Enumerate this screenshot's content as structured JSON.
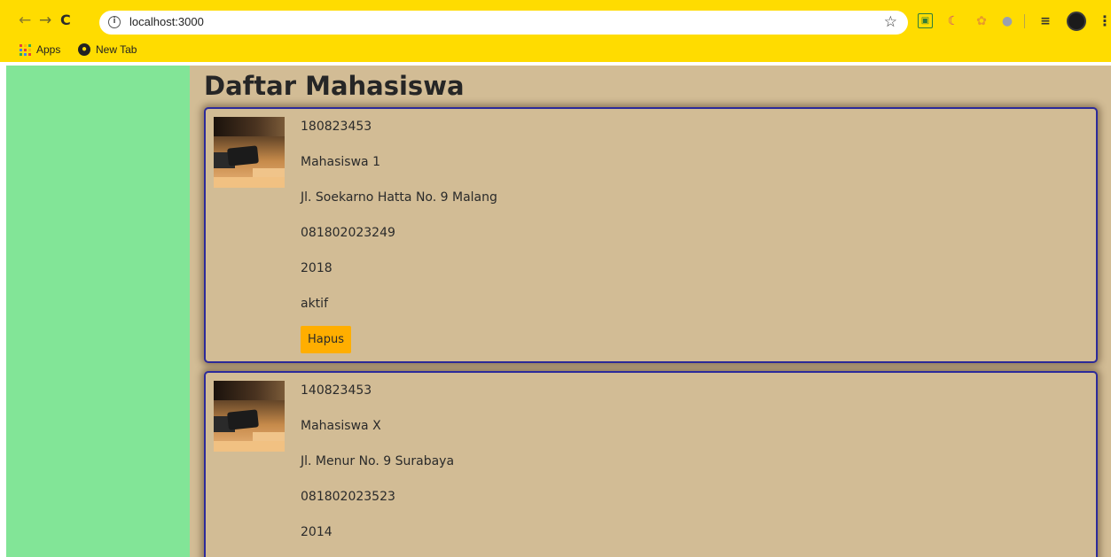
{
  "browser": {
    "back_icon": "arrow-left-icon",
    "forward_icon": "arrow-right-icon",
    "reload_icon": "reload-icon",
    "url": "localhost:3000",
    "bookmarks": [
      {
        "label": "Apps",
        "icon": "apps-grid-icon"
      },
      {
        "label": "New Tab",
        "icon": "globe-icon"
      }
    ],
    "accent_color": "#ffdc00"
  },
  "page": {
    "title": "Daftar Mahasiswa",
    "sidebar_color": "#82e597",
    "main_color": "#d2bc95",
    "card_border_color": "#2c2a9a",
    "button_color": "#ffae00"
  },
  "students": [
    {
      "nim": "180823453",
      "nama": "Mahasiswa 1",
      "alamat": "Jl. Soekarno Hatta No. 9 Malang",
      "hp": "081802023249",
      "angkatan": "2018",
      "status": "aktif",
      "delete_label": "Hapus"
    },
    {
      "nim": "140823453",
      "nama": "Mahasiswa X",
      "alamat": "Jl. Menur No. 9 Surabaya",
      "hp": "081802023523",
      "angkatan": "2014"
    }
  ]
}
